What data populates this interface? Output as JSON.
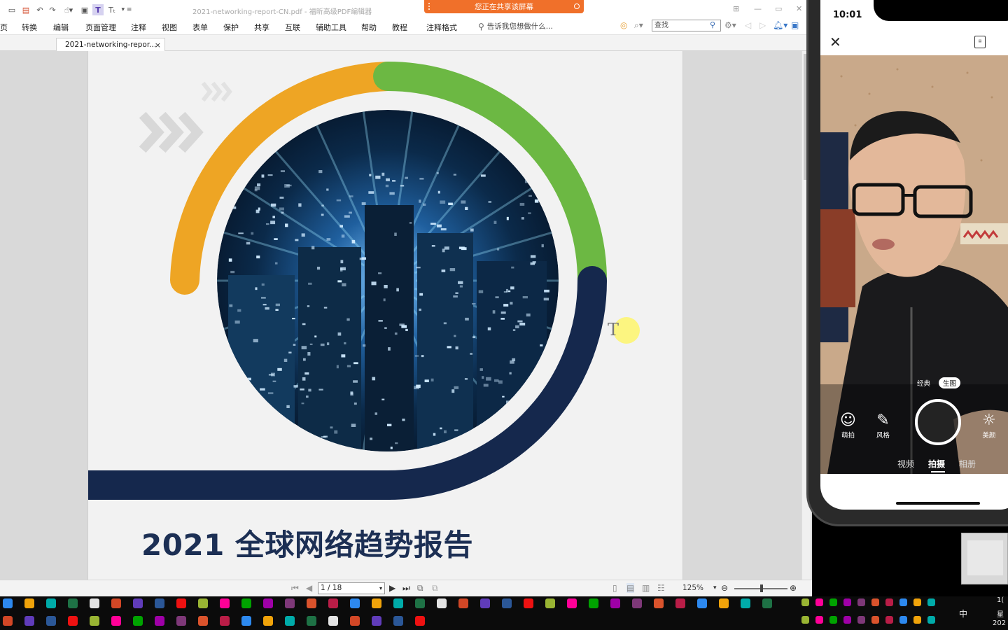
{
  "window": {
    "title": "2021-networking-report-CN.pdf - 福昕高级PDF编辑器",
    "share_banner": "您正在共享该屏幕"
  },
  "menu": {
    "items": [
      "页",
      "转换",
      "编辑",
      "页面管理",
      "注释",
      "视图",
      "表单",
      "保护",
      "共享",
      "互联",
      "辅助工具",
      "帮助",
      "教程",
      "注释格式"
    ],
    "tell_me": "告诉我您想做什么...",
    "search_placeholder": "查找"
  },
  "tab": {
    "label": "2021-networking-repor...",
    "close": "×"
  },
  "document": {
    "title": "2021 全球网络趋势报告",
    "colors": {
      "orange": "#eea524",
      "green": "#6cb843",
      "navy": "#15284d",
      "chevrons": "#d8d8d8"
    }
  },
  "status": {
    "page_value": "1 / 18",
    "zoom": "125%"
  },
  "phone": {
    "time": "10:01",
    "modes": [
      "经典",
      "生图"
    ],
    "tools": [
      {
        "icon": "smile-icon",
        "glyph": "☺",
        "label": "萌拍"
      },
      {
        "icon": "magic-wand-icon",
        "glyph": "✎",
        "label": "风格"
      },
      {
        "icon": "beauty-icon",
        "glyph": "☼",
        "label": "美颜"
      }
    ],
    "tabs": [
      "视频",
      "拍摄",
      "相册"
    ],
    "active_tab": "拍摄"
  },
  "taskbar": {
    "ime": "中",
    "clock_lines": [
      "1(",
      "星",
      "202"
    ]
  }
}
